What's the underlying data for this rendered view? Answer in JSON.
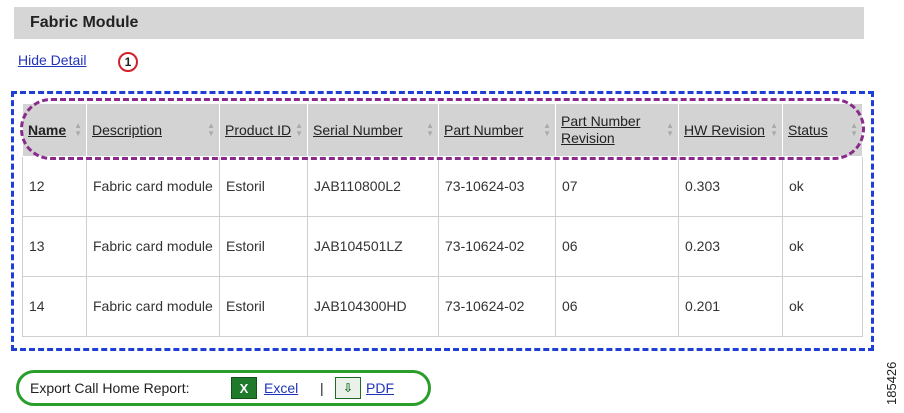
{
  "section": {
    "title": "Fabric Module"
  },
  "links": {
    "hide_detail": "Hide Detail"
  },
  "callout": {
    "number": "1"
  },
  "table": {
    "headers": [
      {
        "label": "Name",
        "sorted": true
      },
      {
        "label": "Description",
        "sorted": false
      },
      {
        "label": "Product ID",
        "sorted": false
      },
      {
        "label": "Serial Number",
        "sorted": false
      },
      {
        "label": "Part Number",
        "sorted": false
      },
      {
        "label": "Part Number Revision",
        "sorted": false
      },
      {
        "label": "HW Revision",
        "sorted": false
      },
      {
        "label": "Status",
        "sorted": false
      }
    ],
    "rows": [
      [
        "12",
        "Fabric card module",
        "Estoril",
        "JAB110800L2",
        "73-10624-03",
        "07",
        "0.303",
        "ok"
      ],
      [
        "13",
        "Fabric card module",
        "Estoril",
        "JAB104501LZ",
        "73-10624-02",
        "06",
        "0.203",
        "ok"
      ],
      [
        "14",
        "Fabric card module",
        "Estoril",
        "JAB104300HD",
        "73-10624-02",
        "06",
        "0.201",
        "ok"
      ]
    ]
  },
  "export": {
    "label": "Export Call Home Report:",
    "excel_label": "Excel",
    "separator": "|",
    "pdf_label": "PDF",
    "excel_icon": "excel-icon",
    "pdf_icon": "pdf-icon"
  },
  "figure_id": "185426",
  "colors": {
    "header_bg": "#d6d6d6",
    "link": "#2233bb",
    "callout_red": "#d41f2a",
    "blue_dash": "#1d3fd6",
    "purple_dash": "#8a2b8c",
    "green_outline": "#2a9d2a"
  }
}
